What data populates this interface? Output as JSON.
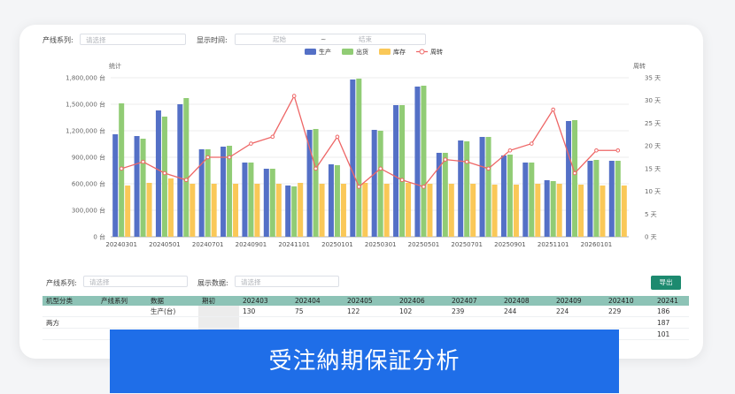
{
  "filters": {
    "line_label": "产线系列:",
    "line_placeholder": "请选择",
    "time_label": "显示时间:",
    "start_placeholder": "起始",
    "range_sep": "~",
    "end_placeholder": "结束"
  },
  "bottom_filters": {
    "line_label": "产线系列:",
    "line_placeholder": "请选择",
    "data_label": "展示数据:",
    "data_placeholder": "请选择",
    "export_label": "导出"
  },
  "chart_data": {
    "type": "bar",
    "legend": [
      "生产",
      "出货",
      "库存",
      "周转"
    ],
    "ylabel_left": "统计",
    "ylabel_right": "周转",
    "categories": [
      "20240301",
      "20240401",
      "20240501",
      "20240601",
      "20240701",
      "20240801",
      "20240901",
      "20241001",
      "20241101",
      "20241201",
      "20250101",
      "20250201",
      "20250301",
      "20250401",
      "20250501",
      "20250601",
      "20250701",
      "20250801",
      "20250901",
      "20251001",
      "20251101",
      "20251201",
      "20260101",
      "20260201"
    ],
    "x_tick_labels": [
      "20240301",
      "20240501",
      "20240701",
      "20240901",
      "20241101",
      "20250101",
      "20250301",
      "20250501",
      "20250701",
      "20250901",
      "20251101",
      "20260101"
    ],
    "y_left_ticks": [
      "0 台",
      "300,000 台",
      "600,000 台",
      "900,000 台",
      "1,200,000 台",
      "1,500,000 台",
      "1,800,000 台"
    ],
    "y_right_ticks": [
      "0 天",
      "5 天",
      "10 天",
      "15 天",
      "20 天",
      "25 天",
      "30 天",
      "35 天"
    ],
    "ylim_left": [
      0,
      1800000
    ],
    "ylim_right": [
      0,
      35
    ],
    "series": [
      {
        "name": "生产",
        "type": "bar",
        "color": "#5470c6",
        "values": [
          1160000,
          1140000,
          1430000,
          1500000,
          990000,
          1020000,
          840000,
          770000,
          580000,
          1210000,
          820000,
          1780000,
          1210000,
          1490000,
          1700000,
          950000,
          1090000,
          1130000,
          920000,
          840000,
          640000,
          1310000,
          860000,
          860000
        ]
      },
      {
        "name": "出货",
        "type": "bar",
        "color": "#91cc75",
        "values": [
          1510000,
          1110000,
          1360000,
          1570000,
          990000,
          1030000,
          840000,
          770000,
          570000,
          1220000,
          810000,
          1790000,
          1200000,
          1490000,
          1710000,
          950000,
          1080000,
          1130000,
          930000,
          840000,
          630000,
          1320000,
          870000,
          860000
        ]
      },
      {
        "name": "库存",
        "type": "bar",
        "color": "#fac858",
        "values": [
          580000,
          610000,
          660000,
          600000,
          600000,
          600000,
          600000,
          600000,
          610000,
          600000,
          600000,
          610000,
          600000,
          610000,
          600000,
          600000,
          600000,
          590000,
          590000,
          600000,
          600000,
          590000,
          580000,
          580000
        ]
      },
      {
        "name": "周转",
        "type": "line",
        "color": "#ee6666",
        "axis": "right",
        "values": [
          15,
          16.5,
          14,
          12.5,
          17.5,
          17.5,
          20.5,
          22,
          31,
          15,
          22,
          11,
          15,
          12.5,
          11,
          17,
          16.5,
          15,
          19,
          20.5,
          28,
          14,
          19,
          19
        ]
      }
    ]
  },
  "table": {
    "columns": [
      "机型分类",
      "产线系列",
      "数据",
      "期初",
      "202403",
      "202404",
      "202405",
      "202406",
      "202407",
      "202408",
      "202409",
      "202410",
      "20241"
    ],
    "rows": [
      {
        "group": "",
        "data": "生产(台)",
        "values": [
          "130",
          "75",
          "122",
          "102",
          "239",
          "244",
          "224",
          "229",
          "186"
        ]
      },
      {
        "group": "两方",
        "data": "",
        "values": [
          "",
          "",
          "",
          "",
          "",
          "",
          "",
          "",
          "187"
        ]
      },
      {
        "group": "",
        "data": "",
        "values": [
          "",
          "",
          "",
          "",
          "",
          "",
          "",
          "",
          "101"
        ]
      }
    ]
  },
  "banner": "受注納期保証分析"
}
